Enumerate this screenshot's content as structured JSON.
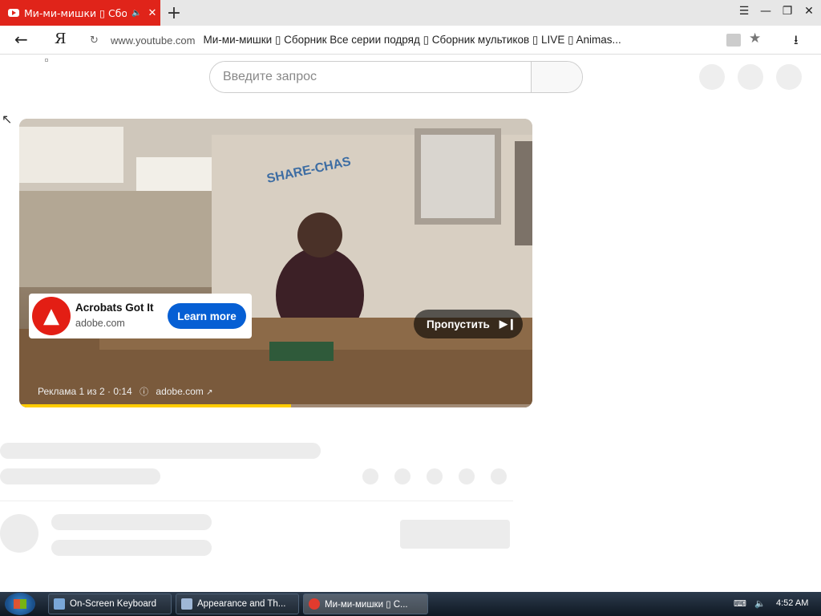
{
  "browser": {
    "tab": {
      "title": "Ми-ми-мишки ▯ Сборник"
    },
    "address": {
      "domain": "www.youtube.com",
      "page_title": "Ми-ми-мишки ▯ Сборник Все серии подряд ▯ Сборник мультиков ▯ LIVE ▯ Animas..."
    },
    "logo": "Я"
  },
  "youtube": {
    "search": {
      "placeholder": "Введите запрос"
    }
  },
  "ad": {
    "advertiser": "Acrobats Got It",
    "site": "adobe.com",
    "cta": "Learn more",
    "skip_label": "Пропустить",
    "info_text": "Реклама 1 из 2 · 0:14",
    "info_site": "adobe.com",
    "progress": 0.53,
    "colors": {
      "logo": "#e31e14",
      "cta": "#065fd4",
      "progress": "#ffcc00"
    }
  },
  "taskbar": {
    "items": [
      {
        "label": "On-Screen Keyboard"
      },
      {
        "label": "Appearance and Th..."
      },
      {
        "label": "Ми-ми-мишки ▯ С..."
      }
    ],
    "clock": "4:52 AM"
  }
}
